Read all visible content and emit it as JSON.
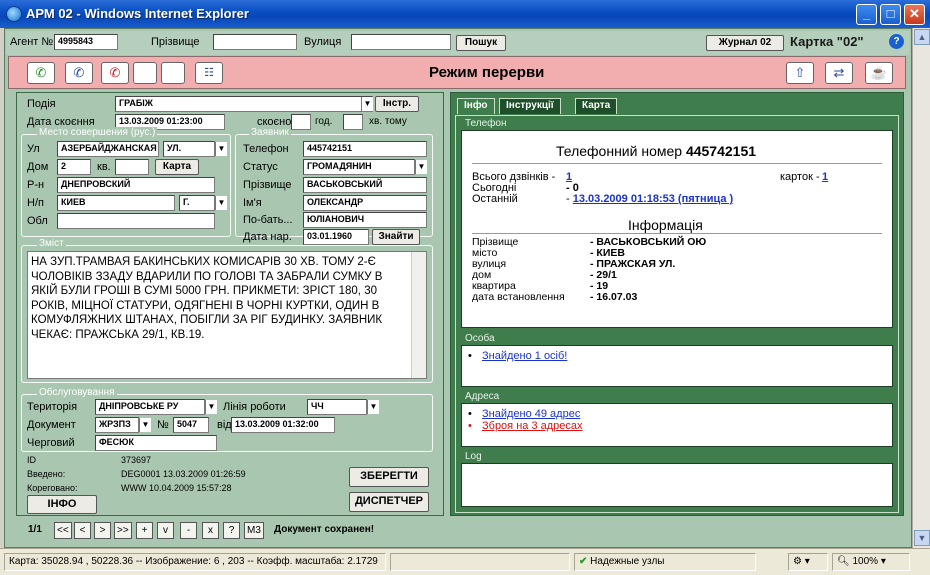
{
  "window": {
    "title": "АРМ 02 - Windows Internet Explorer"
  },
  "topbar": {
    "agent_label": "Агент №",
    "agent_value": "4995843",
    "surname_label": "Прізвище",
    "surname_value": "",
    "street_label": "Вулиця",
    "street_value": "",
    "search_button": "Пошук",
    "journal_button": "Журнал 02",
    "card_title": "Картка \"02\""
  },
  "toolbar": {
    "mode_text": "Режим перерви"
  },
  "event": {
    "event_label": "Подія",
    "event_value": "ГРАБІЖ",
    "instr_button": "Інстр.",
    "date_label": "Дата скоєння",
    "date_value": "13.03.2009 01:23:00",
    "ago_label": "скоєно",
    "hours_label": "год.",
    "minutes_label": "хв. тому"
  },
  "place": {
    "legend": "Место совершения (рус.)",
    "street_label": "Ул",
    "street_value": "АЗЕРБАЙДЖАНСКАЯ",
    "street_type": "УЛ.",
    "house_label": "Дом",
    "house_value": "2",
    "apt_label": "кв.",
    "apt_value": "",
    "map_button": "Карта",
    "district_label": "Р-н",
    "district_value": "ДНЕПРОВСКИЙ",
    "city_label": "Н/п",
    "city_value": "КИЕВ",
    "city_type": "Г.",
    "region_label": "Обл",
    "region_value": ""
  },
  "applicant": {
    "legend": "Заявник",
    "phone_label": "Телефон",
    "phone_value": "445742151",
    "status_label": "Статус",
    "status_value": "ГРОМАДЯНИН",
    "surname_label": "Прізвище",
    "surname_value": "ВАСЬКОВСЬКИЙ",
    "name_label": "Ім'я",
    "name_value": "ОЛЕКСАНДР",
    "patronymic_label": "По-бать...",
    "patronymic_value": "ЮЛІАНОВИЧ",
    "birth_label": "Дата нар.",
    "birth_value": "03.01.1960",
    "find_button": "Знайти"
  },
  "content": {
    "legend": "Зміст",
    "text": "НА ЗУП.ТРАМВАЯ БАКИНСЬКИХ КОМИСАРІВ 30 ХВ. ТОМУ 2-Є ЧОЛОВІКІВ ЗЗАДУ ВДАРИЛИ ПО ГОЛОВІ ТА ЗАБРАЛИ СУМКУ В ЯКІЙ БУЛИ  ГРОШІ В СУМІ 5000 ГРН. ПРИКМЕТИ: ЗРІСТ 180, 30 РОКІВ, МІЦНОЇ СТАТУРИ, ОДЯГНЕНІ В ЧОРНІ КУРТКИ, ОДИН В КОМУФЛЯЖНИХ ШТАНАХ, ПОБІГЛИ ЗА РІГ БУДИНКУ. ЗАЯВНИК ЧЕКАЄ: ПРАЖСЬКА 29/1, КВ.19."
  },
  "service": {
    "legend": "Обслуговування",
    "territory_label": "Територія",
    "territory_value": "ДНІПРОВСЬКЕ РУ",
    "line_label": "Лінія роботи",
    "line_value": "ЧЧ",
    "doc_label": "Документ",
    "doc_value": "ЖРЗПЗ",
    "num_label": "№",
    "num_value": "5047",
    "from_label": "від",
    "from_value": "13.03.2009 01:32:00",
    "duty_label": "Черговий",
    "duty_value": "ФЕСЮК"
  },
  "record": {
    "id_label": "ID",
    "id_value": "373697",
    "created_label": "Введено:",
    "created_value": "DEG0001 13.03.2009 01:26:59",
    "edited_label": "Кореговано:",
    "edited_value": "WWW 10.04.2009 15:57:28",
    "save_button": "ЗБЕРЕГТИ",
    "info_button": "ІНФО",
    "dispatcher_button": "ДИСПЕТЧЕР"
  },
  "tabs": [
    "Інфо",
    "Інструкції",
    "Карта"
  ],
  "phone_box": {
    "legend": "Телефон",
    "heading": "Телефонний номер",
    "number": "445742151",
    "calls_label": "Всього дзвінків -",
    "calls_value": "1",
    "cards_label": "карток -",
    "cards_value": "1",
    "today_label": "Сьогодні",
    "today_value": "- 0",
    "last_label": "Останній",
    "last_value": "13.03.2009 01:18:53 (пятница )",
    "info_heading": "Інформація",
    "rows": [
      {
        "label": "Прізвище",
        "value": "- ВАСЬКОВСЬКИЙ ОЮ"
      },
      {
        "label": "місто",
        "value": "- КИЕВ"
      },
      {
        "label": "вулиця",
        "value": "- ПРАЖСКАЯ УЛ."
      },
      {
        "label": "дом",
        "value": "- 29/1"
      },
      {
        "label": "квартира",
        "value": "- 19"
      },
      {
        "label": "дата встановлення",
        "value": "- 16.07.03"
      }
    ]
  },
  "person_box": {
    "legend": "Особа",
    "link": "Знайдено 1 осіб!"
  },
  "address_box": {
    "legend": "Адреса",
    "link1": "Знайдено 49 адрес",
    "link2": "Зброя на 3 адресах"
  },
  "log_box": {
    "legend": "Log"
  },
  "navbar": {
    "pages": "1/1",
    "buttons": [
      "<<",
      "<",
      ">",
      ">>",
      "+",
      "v",
      "-",
      "x",
      "?",
      "M3"
    ],
    "message": "Документ сохранен!"
  },
  "statusbar": {
    "map_info": "Карта: 35028.94 , 50228.36 -- Изображение: 6 , 203 -- Коэфф. масштаба: 2.1729",
    "zone": "Надежные узлы",
    "zoom": "100%"
  }
}
